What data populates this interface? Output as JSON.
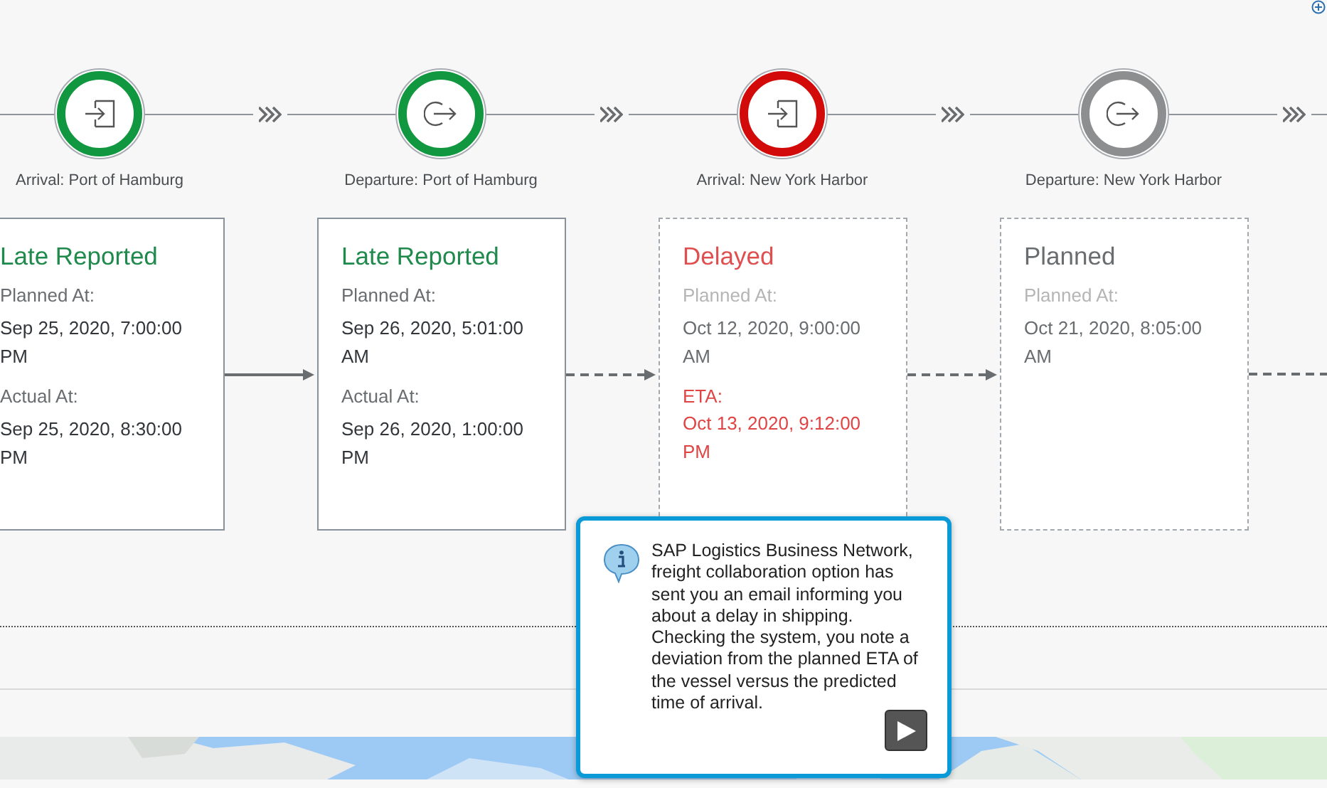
{
  "stops": [
    {
      "label": "Arrival: Port of Hamburg",
      "kind": "arrival",
      "color": "#10973f"
    },
    {
      "label": "Departure: Port of Hamburg",
      "kind": "departure",
      "color": "#10973f"
    },
    {
      "label": "Arrival: New York Harbor",
      "kind": "arrival",
      "color": "#d20a0a"
    },
    {
      "label": "Departure: New York Harbor",
      "kind": "departure",
      "color": "#8d8e90"
    }
  ],
  "cards": [
    {
      "title": "Late Reported",
      "color": "#1f8a4c",
      "dashed": false,
      "connector_dashed": false,
      "fields": [
        {
          "label": "Planned At:",
          "value": "Sep 25, 2020, 7:00:00 PM",
          "kind": "normal"
        },
        {
          "label": "Actual At:",
          "value": "Sep 25, 2020, 8:30:00 PM",
          "kind": "normal"
        }
      ]
    },
    {
      "title": "Late Reported",
      "color": "#1f8a4c",
      "dashed": false,
      "connector_dashed": true,
      "fields": [
        {
          "label": "Planned At:",
          "value": "Sep 26, 2020, 5:01:00 AM",
          "kind": "normal"
        },
        {
          "label": "Actual At:",
          "value": "Sep 26, 2020, 1:00:00 PM",
          "kind": "normal"
        }
      ]
    },
    {
      "title": "Delayed",
      "color": "#df4f4f",
      "dashed": true,
      "connector_dashed": true,
      "fields": [
        {
          "label": "Planned At:",
          "value": "Oct 12, 2020, 9:00:00 AM",
          "kind": "muted"
        },
        {
          "label": "ETA:",
          "value": "Oct 13, 2020, 9:12:00 PM",
          "kind": "alert"
        }
      ]
    },
    {
      "title": "Planned",
      "color": "#6a6d70",
      "dashed": true,
      "connector_dashed": true,
      "fields": [
        {
          "label": "Planned At:",
          "value": "Oct 21, 2020, 8:05:00 AM",
          "kind": "muted"
        }
      ]
    }
  ],
  "callout": {
    "text": "SAP Logistics Business Network, freight collaboration option has sent you an email informing you about a delay in shipping. Checking the system, you note a deviation from the planned ETA of the vessel versus the predicted time of arrival."
  }
}
